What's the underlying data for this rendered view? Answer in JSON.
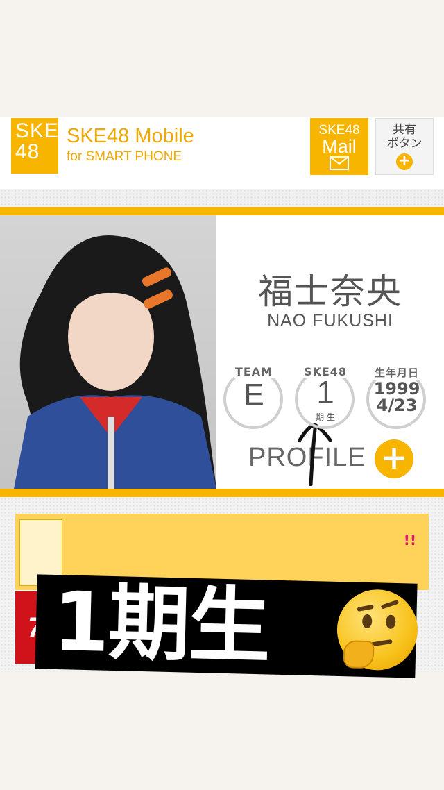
{
  "header": {
    "logo_text": "SKE\n48",
    "brand_title": "SKE48 Mobile",
    "brand_subtitle": "for SMART PHONE",
    "mail_top": "SKE48",
    "mail_bottom": "Mail",
    "share_line1": "共有",
    "share_line2": "ボタン",
    "share_plus": "+"
  },
  "profile": {
    "name_kanji": "福士奈央",
    "name_romaji": "NAO FUKUSHI",
    "team_caption": "TEAM",
    "team_value": "E",
    "gen_caption": "SKE48",
    "gen_value": "1",
    "gen_sub": "期 生",
    "birthday_caption": "生年月日",
    "birthday_year": "1999",
    "birthday_date": "4/23",
    "profile_label": "PROFILE",
    "profile_plus": "+"
  },
  "links": {
    "banner_exclaim": "!!",
    "tile_755": "755"
  },
  "overlay": {
    "caption": "1期生",
    "emoji": "thinking-face",
    "arrow_icon": "arrow-up-icon"
  },
  "colors": {
    "accent": "#f7b500",
    "red_755": "#d0121b",
    "instagram": "#d6336c"
  }
}
